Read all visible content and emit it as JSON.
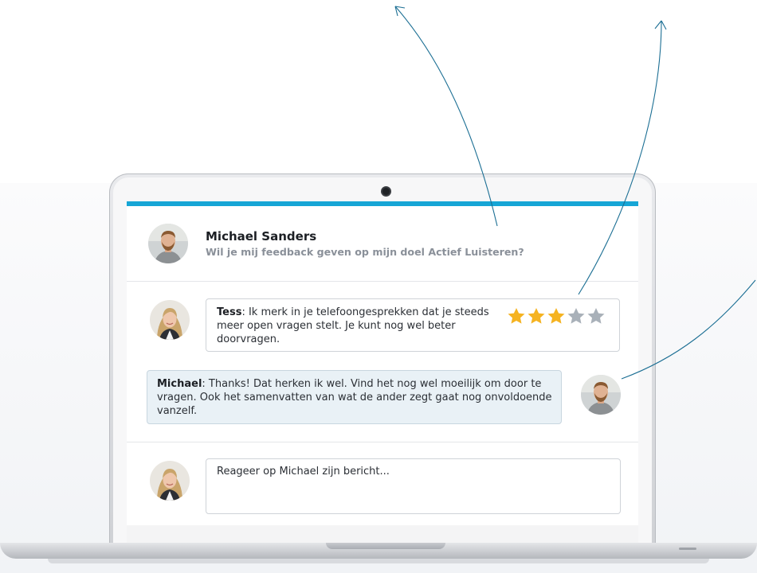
{
  "post": {
    "author": "Michael Sanders",
    "question": "Wil je mij feedback geven op mijn doel Actief Luisteren?"
  },
  "comments": [
    {
      "author": "Tess",
      "text": ": Ik merk in je telefoongesprekken dat je steeds meer open vragen stelt. Je kunt nog wel beter doorvragen.",
      "rating": 3,
      "rating_max": 5
    },
    {
      "author": "Michael",
      "text": ": Thanks! Dat herken ik wel. Vind het nog wel moeilijk om door te vragen. Ook het samenvatten van wat de ander zegt gaat nog onvoldoende vanzelf."
    }
  ],
  "reply": {
    "placeholder": "Reageer op Michael zijn bericht..."
  },
  "icons": {
    "star_filled": "star-icon",
    "star_empty": "star-empty-icon"
  },
  "colors": {
    "accent": "#16a6d6",
    "star_filled": "#f5b321",
    "star_empty": "#a9b1b9",
    "annotation_arrow": "#1c6f94",
    "own_message_bg": "#e9f1f6"
  }
}
